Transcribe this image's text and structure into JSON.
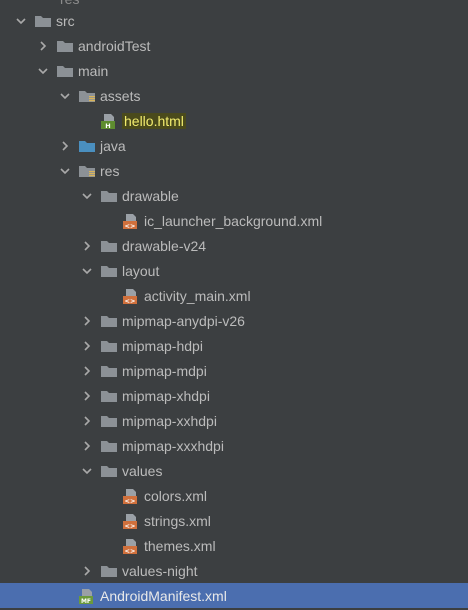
{
  "tree": {
    "top_cut_label": "res",
    "items": [
      {
        "label": "src",
        "level": 1,
        "expanded": true,
        "type": "folder"
      },
      {
        "label": "androidTest",
        "level": 2,
        "expanded": false,
        "type": "folder"
      },
      {
        "label": "main",
        "level": 2,
        "expanded": true,
        "type": "folder"
      },
      {
        "label": "assets",
        "level": 3,
        "expanded": true,
        "type": "folder-res"
      },
      {
        "label": "hello.html",
        "level": 4,
        "type": "html-file",
        "highlight": true
      },
      {
        "label": "java",
        "level": 3,
        "expanded": false,
        "type": "folder-src"
      },
      {
        "label": "res",
        "level": 3,
        "expanded": true,
        "type": "folder-res"
      },
      {
        "label": "drawable",
        "level": 4,
        "expanded": true,
        "type": "folder"
      },
      {
        "label": "ic_launcher_background.xml",
        "level": 5,
        "type": "xml-file"
      },
      {
        "label": "drawable-v24",
        "level": 4,
        "expanded": false,
        "type": "folder"
      },
      {
        "label": "layout",
        "level": 4,
        "expanded": true,
        "type": "folder"
      },
      {
        "label": "activity_main.xml",
        "level": 5,
        "type": "xml-file"
      },
      {
        "label": "mipmap-anydpi-v26",
        "level": 4,
        "expanded": false,
        "type": "folder"
      },
      {
        "label": "mipmap-hdpi",
        "level": 4,
        "expanded": false,
        "type": "folder"
      },
      {
        "label": "mipmap-mdpi",
        "level": 4,
        "expanded": false,
        "type": "folder"
      },
      {
        "label": "mipmap-xhdpi",
        "level": 4,
        "expanded": false,
        "type": "folder"
      },
      {
        "label": "mipmap-xxhdpi",
        "level": 4,
        "expanded": false,
        "type": "folder"
      },
      {
        "label": "mipmap-xxxhdpi",
        "level": 4,
        "expanded": false,
        "type": "folder"
      },
      {
        "label": "values",
        "level": 4,
        "expanded": true,
        "type": "folder"
      },
      {
        "label": "colors.xml",
        "level": 5,
        "type": "xml-file"
      },
      {
        "label": "strings.xml",
        "level": 5,
        "type": "xml-file"
      },
      {
        "label": "themes.xml",
        "level": 5,
        "type": "xml-file"
      },
      {
        "label": "values-night",
        "level": 4,
        "expanded": false,
        "type": "folder"
      },
      {
        "label": "AndroidManifest.xml",
        "level": 3,
        "type": "manifest-file",
        "selected": true
      }
    ]
  },
  "colors": {
    "background": "#3c3f41",
    "selection": "#4b6eaf",
    "folder": "#8c9196",
    "folder_src": "#4a8fbf",
    "xml_icon": "#d0703c",
    "html_icon": "#5e8c2f",
    "manifest_icon": "#6b9a3c",
    "highlight_text": "#f2ec6e"
  },
  "icons": {
    "expanded": "chevron-down-icon",
    "collapsed": "chevron-right-icon",
    "folder": "folder-icon",
    "xml": "xml-file-icon",
    "html": "html-file-icon",
    "manifest": "manifest-file-icon"
  }
}
